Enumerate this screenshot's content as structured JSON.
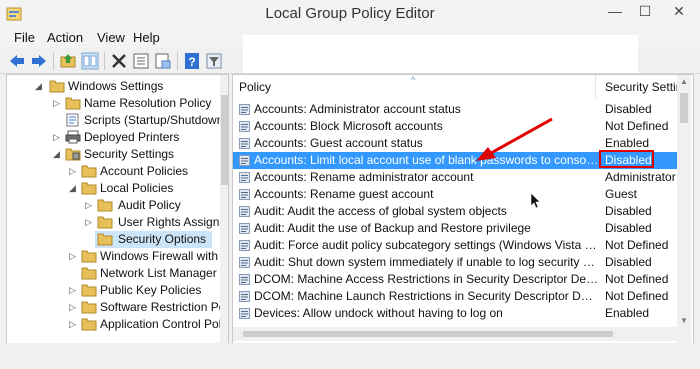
{
  "window": {
    "title": "Local Group Policy Editor",
    "controls": {
      "minimize": "—",
      "maximize": "☐",
      "close": "✕"
    }
  },
  "menu": {
    "items": [
      {
        "label": "File"
      },
      {
        "label": "Action"
      },
      {
        "label": "View"
      },
      {
        "label": "Help"
      }
    ]
  },
  "toolbar": {
    "buttons": [
      "back-icon",
      "forward-icon",
      "up-folder-icon",
      "show-hide-tree-icon",
      "delete-icon",
      "properties-icon",
      "export-list-icon",
      "help-icon",
      "filter-view-icon"
    ]
  },
  "tree": {
    "items": [
      {
        "label": "Windows Settings",
        "expanded": true
      },
      {
        "label": "Name Resolution Policy",
        "expanded": false
      },
      {
        "label": "Scripts (Startup/Shutdown)",
        "expanded": false
      },
      {
        "label": "Deployed Printers",
        "expanded": false
      },
      {
        "label": "Security Settings",
        "expanded": true
      },
      {
        "label": "Account Policies",
        "expanded": false
      },
      {
        "label": "Local Policies",
        "expanded": true
      },
      {
        "label": "Audit Policy",
        "expanded": false
      },
      {
        "label": "User Rights Assignment",
        "expanded": false
      },
      {
        "label": "Security Options",
        "expanded": false,
        "selected": true
      },
      {
        "label": "Windows Firewall with Advanced Security",
        "expanded": false
      },
      {
        "label": "Network List Manager Policies",
        "expanded": false
      },
      {
        "label": "Public Key Policies",
        "expanded": false
      },
      {
        "label": "Software Restriction Policies",
        "expanded": false
      },
      {
        "label": "Application Control Policies",
        "expanded": false
      }
    ]
  },
  "list": {
    "columns": {
      "policy": "Policy",
      "setting": "Security Setting"
    },
    "rows": [
      {
        "policy": "Accounts: Administrator account status",
        "setting": "Disabled"
      },
      {
        "policy": "Accounts: Block Microsoft accounts",
        "setting": "Not Defined"
      },
      {
        "policy": "Accounts: Guest account status",
        "setting": "Enabled"
      },
      {
        "policy": "Accounts: Limit local account use of blank passwords to console logon only",
        "setting": "Disabled",
        "selected": true
      },
      {
        "policy": "Accounts: Rename administrator account",
        "setting": "Administrator"
      },
      {
        "policy": "Accounts: Rename guest account",
        "setting": "Guest"
      },
      {
        "policy": "Audit: Audit the access of global system objects",
        "setting": "Disabled"
      },
      {
        "policy": "Audit: Audit the use of Backup and Restore privilege",
        "setting": "Disabled"
      },
      {
        "policy": "Audit: Force audit policy subcategory settings (Windows Vista or later) to override audit policy category settings",
        "setting": "Not Defined"
      },
      {
        "policy": "Audit: Shut down system immediately if unable to log security audits",
        "setting": "Disabled"
      },
      {
        "policy": "DCOM: Machine Access Restrictions in Security Descriptor Definition Language (SDDL) syntax",
        "setting": "Not Defined"
      },
      {
        "policy": "DCOM: Machine Launch Restrictions in Security Descriptor Definition Language (SDDL) syntax",
        "setting": "Not Defined"
      },
      {
        "policy": "Devices: Allow undock without having to log on",
        "setting": "Enabled"
      }
    ]
  },
  "colors": {
    "selection": "#3399ff",
    "annotation": "#e00000",
    "folder": "#e8c05a"
  }
}
